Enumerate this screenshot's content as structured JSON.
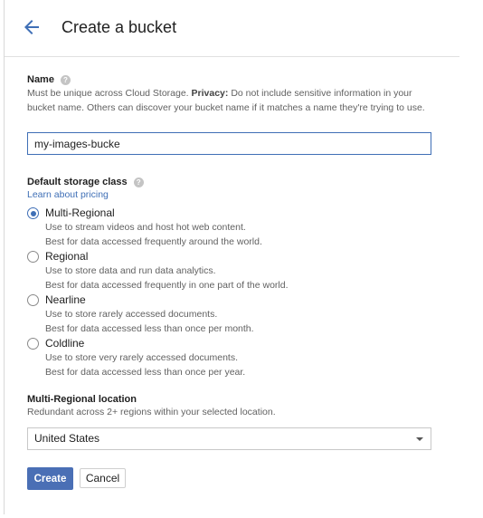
{
  "header": {
    "back_icon": "arrow-left-icon",
    "title": "Create a bucket"
  },
  "name_section": {
    "label": "Name",
    "help_icon": "help-icon",
    "hint_prefix": "Must be unique across Cloud Storage. ",
    "hint_bold": "Privacy:",
    "hint_rest": " Do not include sensitive information in your bucket name. Others can discover your bucket name if it matches a name they're trying to use.",
    "input_value": "my-images-bucke"
  },
  "storage_class": {
    "label": "Default storage class",
    "help_icon": "help-icon",
    "pricing_link": "Learn about pricing",
    "selected": "Multi-Regional",
    "options": [
      {
        "title": "Multi-Regional",
        "desc1": "Use to stream videos and host hot web content.",
        "desc2": "Best for data accessed frequently around the world."
      },
      {
        "title": "Regional",
        "desc1": "Use to store data and run data analytics.",
        "desc2": "Best for data accessed frequently in one part of the world."
      },
      {
        "title": "Nearline",
        "desc1": "Use to store rarely accessed documents.",
        "desc2": "Best for data accessed less than once per month."
      },
      {
        "title": "Coldline",
        "desc1": "Use to store very rarely accessed documents.",
        "desc2": "Best for data accessed less than once per year."
      }
    ]
  },
  "location": {
    "label": "Multi-Regional location",
    "hint": "Redundant across 2+ regions within your selected location.",
    "selected_value": "United States",
    "caret_icon": "caret-down-icon"
  },
  "actions": {
    "create_label": "Create",
    "cancel_label": "Cancel"
  },
  "colors": {
    "accent": "#3f6fb6",
    "primary_button": "#4a6fb5"
  }
}
